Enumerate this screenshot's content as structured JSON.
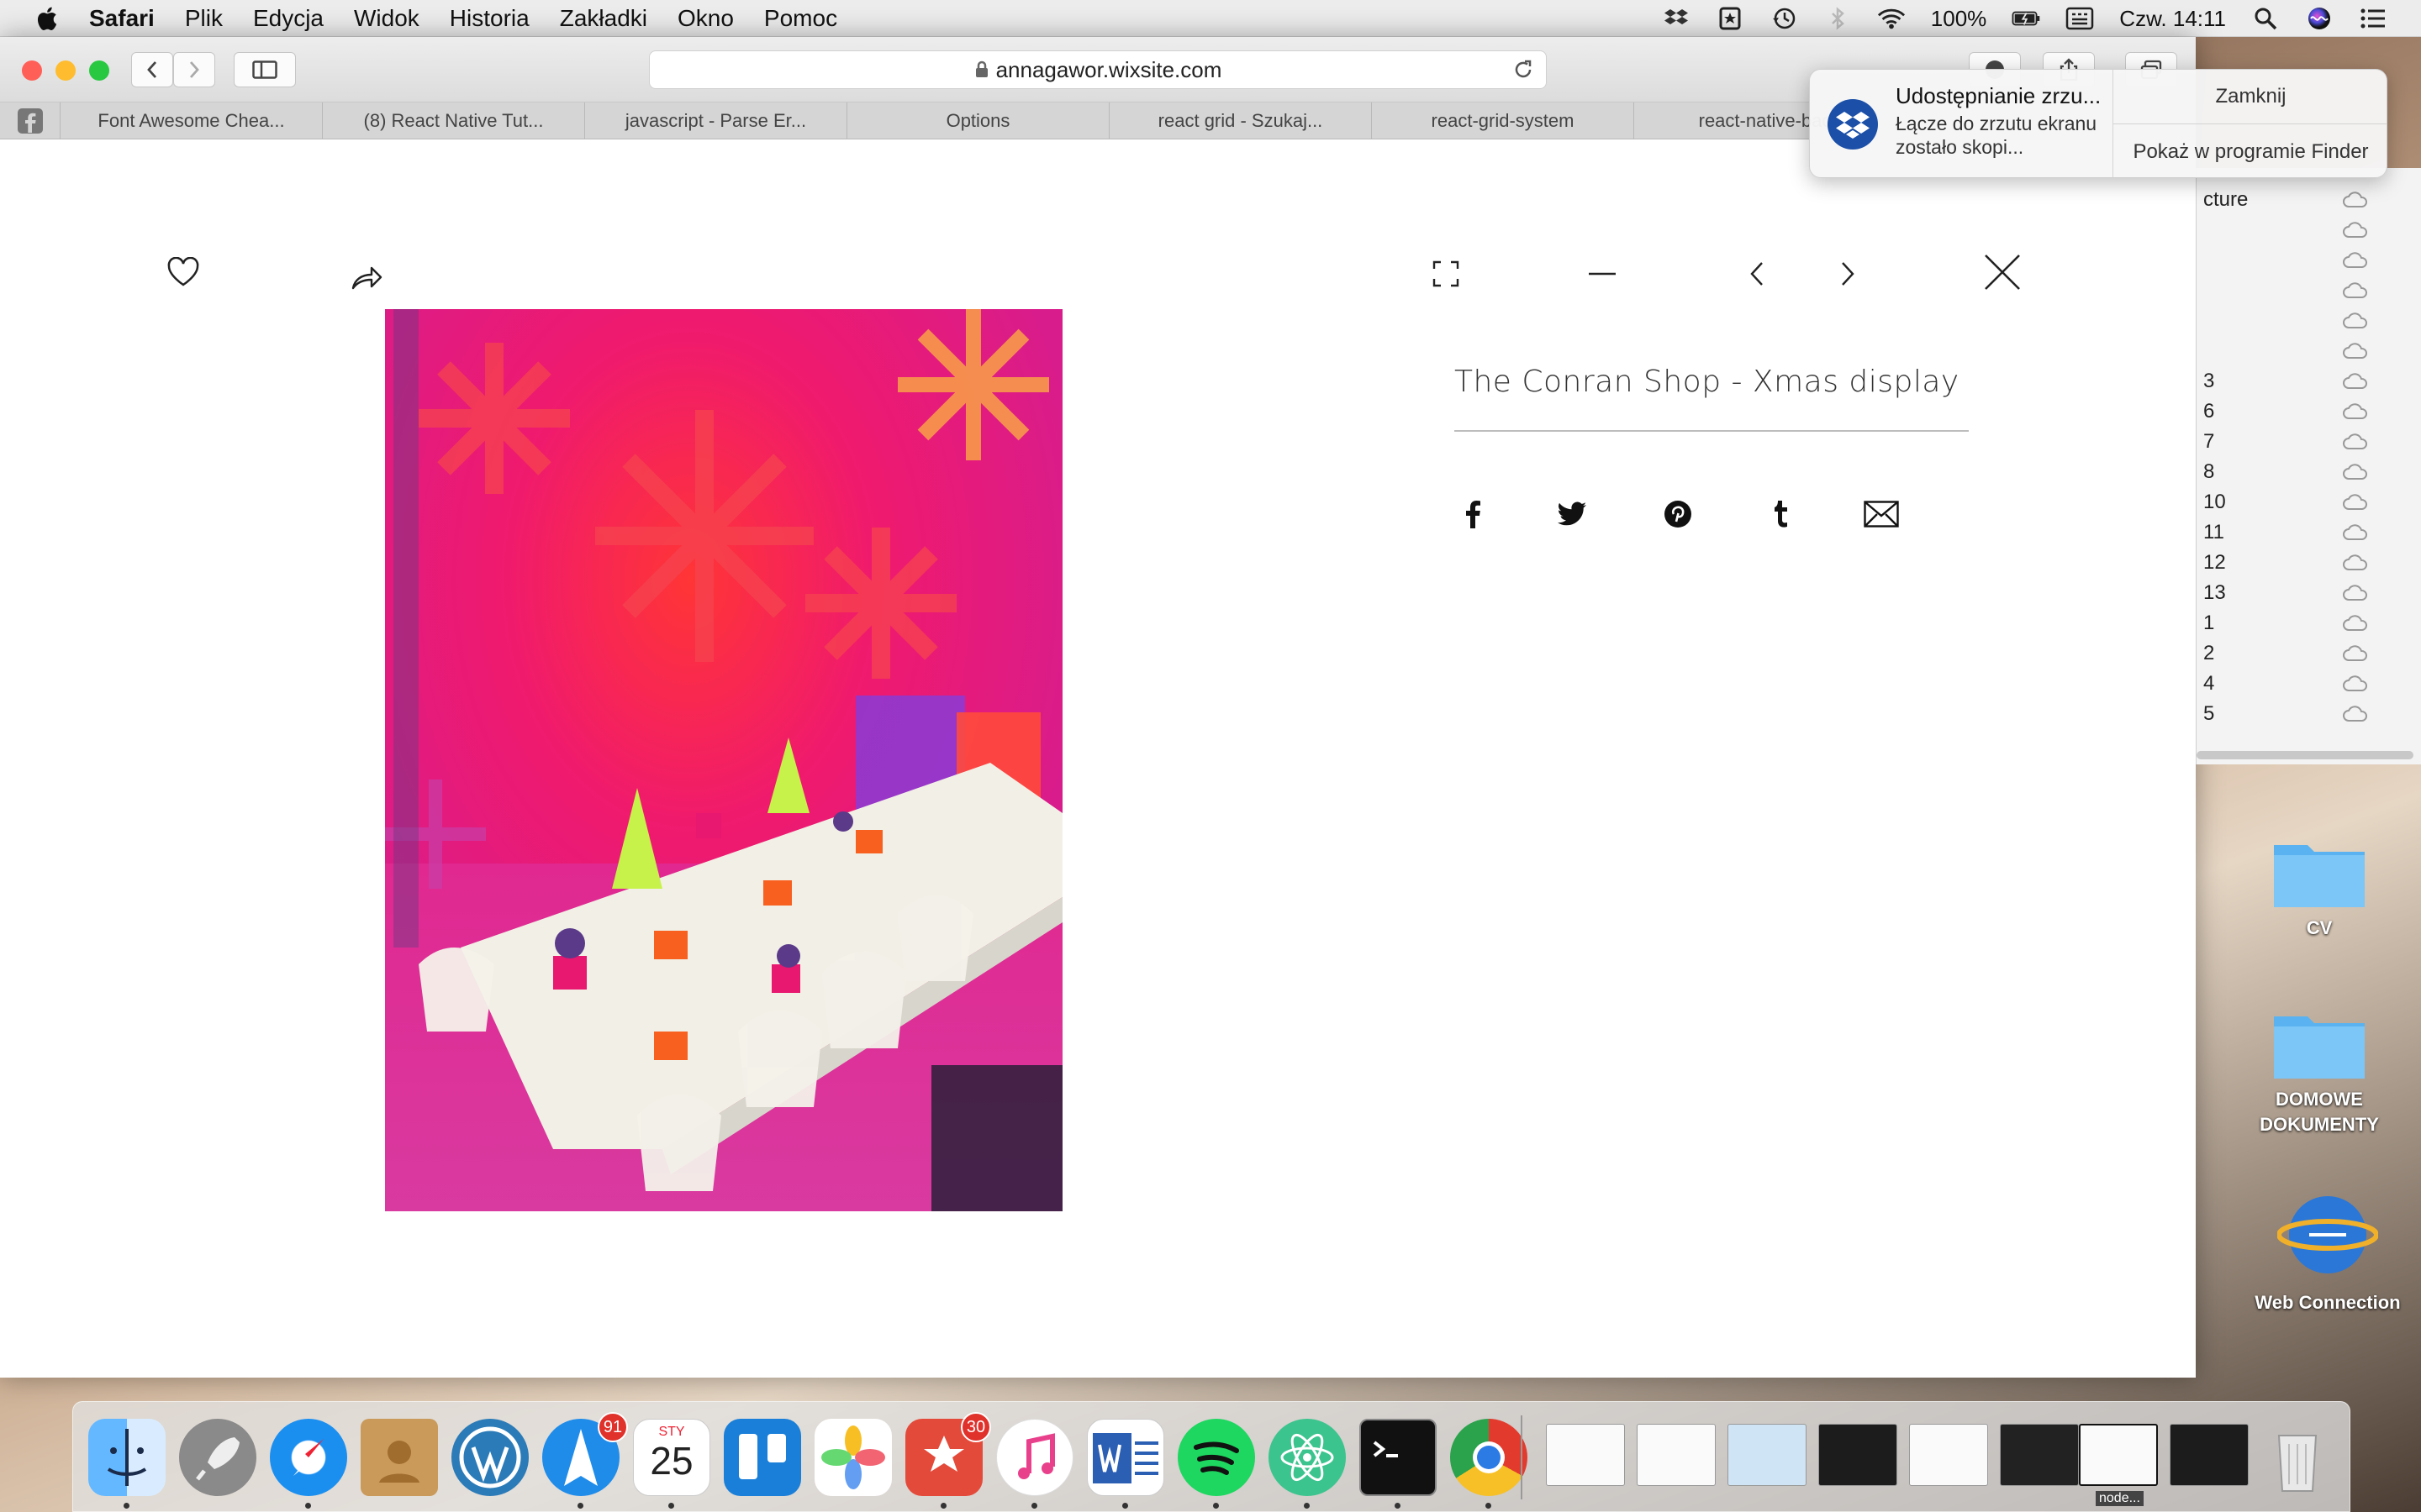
{
  "menubar": {
    "app": "Safari",
    "items": [
      "Plik",
      "Edycja",
      "Widok",
      "Historia",
      "Zakładki",
      "Okno",
      "Pomoc"
    ],
    "battery": "100%",
    "clock": "Czw. 14:11"
  },
  "browser": {
    "url": "annagawor.wixsite.com",
    "tabs": [
      "Font Awesome Chea...",
      "(8) React Native Tut...",
      "javascript - Parse Er...",
      "Options",
      "react grid - Szukaj...",
      "react-grid-system",
      "react-native-bac"
    ]
  },
  "viewer": {
    "title": "The Conran Shop - Xmas display",
    "share_icons": [
      "facebook-icon",
      "twitter-icon",
      "pinterest-icon",
      "tumblr-icon",
      "mail-icon"
    ]
  },
  "notification": {
    "title": "Udostępnianie zrzu...",
    "body": "Łącze do zrzutu ekranu zostało skopi...",
    "close": "Zamknij",
    "show": "Pokaż w programie Finder"
  },
  "finder": {
    "rows": [
      "cture",
      "",
      "",
      "",
      "",
      "",
      "3",
      "6",
      "7",
      "8",
      "10",
      "11",
      "12",
      "13",
      "1",
      "2",
      "4",
      "5"
    ]
  },
  "desktop": {
    "icons": [
      {
        "label": "CV"
      },
      {
        "label": "DOMOWE DOKUMENTY"
      },
      {
        "label": "Web Connection"
      }
    ]
  },
  "dock": {
    "mail_badge": "91",
    "calendar_month": "STY",
    "calendar_day": "25",
    "wunder_badge": "30",
    "thumb_label": "node..."
  },
  "colors": {
    "accent": "#1a82fb",
    "photo_magenta": "#e8197c",
    "red_light": "#ff5f57",
    "yellow_light": "#febc2e",
    "green_light": "#28c840"
  }
}
